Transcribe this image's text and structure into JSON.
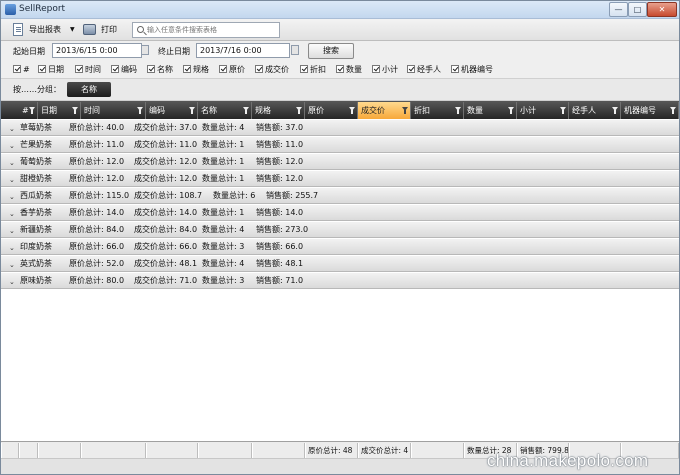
{
  "window": {
    "title": "SellReport"
  },
  "toolbar": {
    "export_label": "导出报表",
    "print_label": "打印",
    "search_placeholder": "输入任意条件搜索表格"
  },
  "filters": {
    "start_label": "起始日期",
    "start_value": "2013/6/15 0:00",
    "end_label": "终止日期",
    "end_value": "2013/7/16 0:00",
    "search_button": "搜索"
  },
  "columns_toggle": [
    "#",
    "日期",
    "时间",
    "编码",
    "名称",
    "规格",
    "原价",
    "成交价",
    "折扣",
    "数量",
    "小计",
    "经手人",
    "机器编号"
  ],
  "grouping": {
    "label": "按……分组：",
    "chip": "名称"
  },
  "grid": {
    "headers": [
      "#",
      "日期",
      "时间",
      "编码",
      "名称",
      "规格",
      "原价",
      "成交价",
      "折扣",
      "数量",
      "小计",
      "经手人",
      "机器编号"
    ],
    "active_header": "成交价",
    "groups": [
      {
        "name": "草莓奶茶",
        "orig": "原价总计: 40.0",
        "deal": "成交价总计: 37.0",
        "qty": "数量总计: 4",
        "sales": "销售额: 37.0"
      },
      {
        "name": "芒果奶茶",
        "orig": "原价总计: 11.0",
        "deal": "成交价总计: 11.0",
        "qty": "数量总计: 1",
        "sales": "销售额: 11.0"
      },
      {
        "name": "葡萄奶茶",
        "orig": "原价总计: 12.0",
        "deal": "成交价总计: 12.0",
        "qty": "数量总计: 1",
        "sales": "销售额: 12.0"
      },
      {
        "name": "甜橙奶茶",
        "orig": "原价总计: 12.0",
        "deal": "成交价总计: 12.0",
        "qty": "数量总计: 1",
        "sales": "销售额: 12.0"
      },
      {
        "name": "西瓜奶茶",
        "orig": "原价总计: 115.0",
        "deal": "成交价总计: 108.7",
        "qty": "数量总计: 6",
        "sales": "销售额: 255.7"
      },
      {
        "name": "香芋奶茶",
        "orig": "原价总计: 14.0",
        "deal": "成交价总计: 14.0",
        "qty": "数量总计: 1",
        "sales": "销售额: 14.0"
      },
      {
        "name": "新疆奶茶",
        "orig": "原价总计: 84.0",
        "deal": "成交价总计: 84.0",
        "qty": "数量总计: 4",
        "sales": "销售额: 273.0"
      },
      {
        "name": "印度奶茶",
        "orig": "原价总计: 66.0",
        "deal": "成交价总计: 66.0",
        "qty": "数量总计: 3",
        "sales": "销售额: 66.0"
      },
      {
        "name": "英式奶茶",
        "orig": "原价总计: 52.0",
        "deal": "成交价总计: 48.1",
        "qty": "数量总计: 4",
        "sales": "销售额: 48.1"
      },
      {
        "name": "原味奶茶",
        "orig": "原价总计: 80.0",
        "deal": "成交价总计: 71.0",
        "qty": "数量总计: 3",
        "sales": "销售额: 71.0"
      }
    ]
  },
  "footer": {
    "orig_total": "原价总计: 48",
    "deal_total": "成交价总计: 4",
    "qty_total": "数量总计: 28",
    "sales_total": "销售额: 799.8"
  },
  "watermark": "china.makepolo.com",
  "colors": {
    "header_bg": "#262626",
    "active_header": "#f7a83a",
    "group_chip": "#1c1c1c"
  }
}
